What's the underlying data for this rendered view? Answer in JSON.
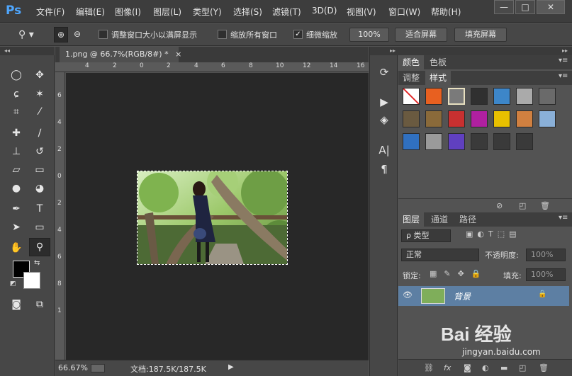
{
  "app": {
    "logo": "Ps"
  },
  "menu": [
    "文件(F)",
    "编辑(E)",
    "图像(I)",
    "图层(L)",
    "类型(Y)",
    "选择(S)",
    "滤镜(T)",
    "3D(D)",
    "视图(V)",
    "窗口(W)",
    "帮助(H)"
  ],
  "window_controls": {
    "minimize": "—",
    "restore": "□",
    "close": "✕"
  },
  "options": {
    "resize_windows": "调整窗口大小以满屏显示",
    "zoom_all_windows": "缩放所有窗口",
    "scrubby_zoom": "细微缩放",
    "btn_100": "100%",
    "btn_fit": "适合屏幕",
    "btn_fill": "填充屏幕",
    "scrubby_checked": true
  },
  "document": {
    "tab_title": "1.png @ 66.7%(RGB/8#) *",
    "tab_close": "×",
    "zoom": "66.67%",
    "doc_info": "文档:187.5K/187.5K"
  },
  "ruler": {
    "h_ticks": [
      "4",
      "2",
      "0",
      "2",
      "4",
      "6",
      "8",
      "10",
      "12",
      "14",
      "16"
    ],
    "v_ticks": [
      "6",
      "4",
      "2",
      "0",
      "2",
      "4",
      "6",
      "8",
      "1"
    ]
  },
  "panels": {
    "top_tabs": [
      "颜色",
      "色板"
    ],
    "second_tabs": [
      "调整",
      "样式"
    ],
    "layer_tabs": [
      "图层",
      "通道",
      "路径"
    ],
    "kind_filter": "ρ 类型",
    "blend_mode": "正常",
    "opacity_label": "不透明度:",
    "opacity_value": "100%",
    "lock_label": "锁定:",
    "fill_label": "填充:",
    "fill_value": "100%",
    "layer_name": "背景"
  },
  "swatch_colors": [
    "#ffffff",
    "#e86020",
    "#7a7a7a",
    "#303030",
    "#3d86c9",
    "#aaaaaa",
    "#6a6a6a",
    "#6a5a40",
    "#8a6a3a",
    "#c83030",
    "#b020a0",
    "#e8c000",
    "#d08040",
    "#8ab0d8",
    "#3070c0",
    "#9a9a9a",
    "#6040c0",
    "#3a3a3a",
    "#3a3a3a",
    "#3a3a3a"
  ],
  "watermark": {
    "brand": "Bai 经验",
    "url": "jingyan.baidu.com"
  }
}
